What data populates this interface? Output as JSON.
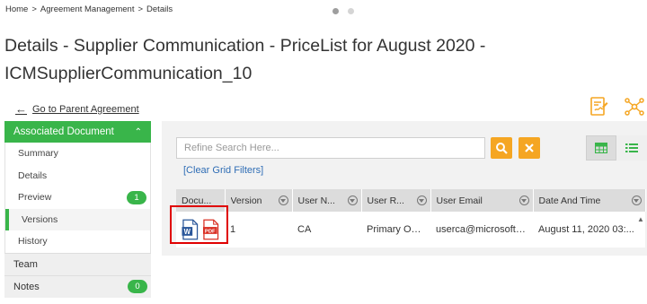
{
  "breadcrumb": {
    "items": [
      "Home",
      "Agreement Management",
      "Details"
    ],
    "separator": ">"
  },
  "page_title": "Details - Supplier Communication - PriceList for August 2020 - ICMSupplierCommunication_10",
  "go_parent_label": "Go to Parent Agreement",
  "sidebar": {
    "header": "Associated Document",
    "items": [
      {
        "label": "Summary"
      },
      {
        "label": "Details"
      },
      {
        "label": "Preview",
        "badge": "1"
      },
      {
        "label": "Versions",
        "active": true
      },
      {
        "label": "History"
      }
    ],
    "sections": [
      {
        "label": "Team"
      },
      {
        "label": "Notes",
        "badge": "0"
      }
    ]
  },
  "search": {
    "placeholder": "Refine Search Here...",
    "clear_filters": "[Clear Grid Filters]"
  },
  "table": {
    "columns": [
      "Docu...",
      "Version",
      "User N...",
      "User R...",
      "User Email",
      "Date And Time"
    ],
    "rows": [
      {
        "version": "1",
        "user_name": "CA",
        "user_role": "Primary Ow...",
        "user_email": "userca@microsoft.c...",
        "date_time": "August 11, 2020 03:..."
      }
    ]
  },
  "icons": {
    "word": "word-document-icon",
    "pdf": "pdf-document-icon",
    "pdf_label": "PDF",
    "word_label": "W"
  },
  "colors": {
    "accent_green": "#39b54a",
    "accent_orange": "#f5a623",
    "link_blue": "#2f6db5",
    "highlight_red": "#e00000"
  }
}
